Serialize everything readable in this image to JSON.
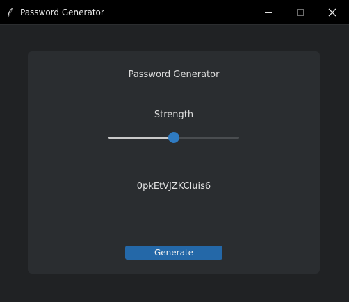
{
  "window": {
    "title": "Password Generator",
    "icon": "feather-icon",
    "controls": {
      "minimize": "minimize-icon",
      "maximize": "maximize-icon",
      "close": "close-icon"
    }
  },
  "panel": {
    "heading": "Password Generator",
    "strength_label": "Strength",
    "strength_level": 0.5,
    "password": "0pkEtVJZKCluis6",
    "generate_label": "Generate"
  },
  "colors": {
    "accent": "#2468a8",
    "slider_thumb": "#2f7bc2",
    "panel_bg": "#2a2d30",
    "window_bg": "#202224",
    "titlebar_bg": "#000000"
  }
}
